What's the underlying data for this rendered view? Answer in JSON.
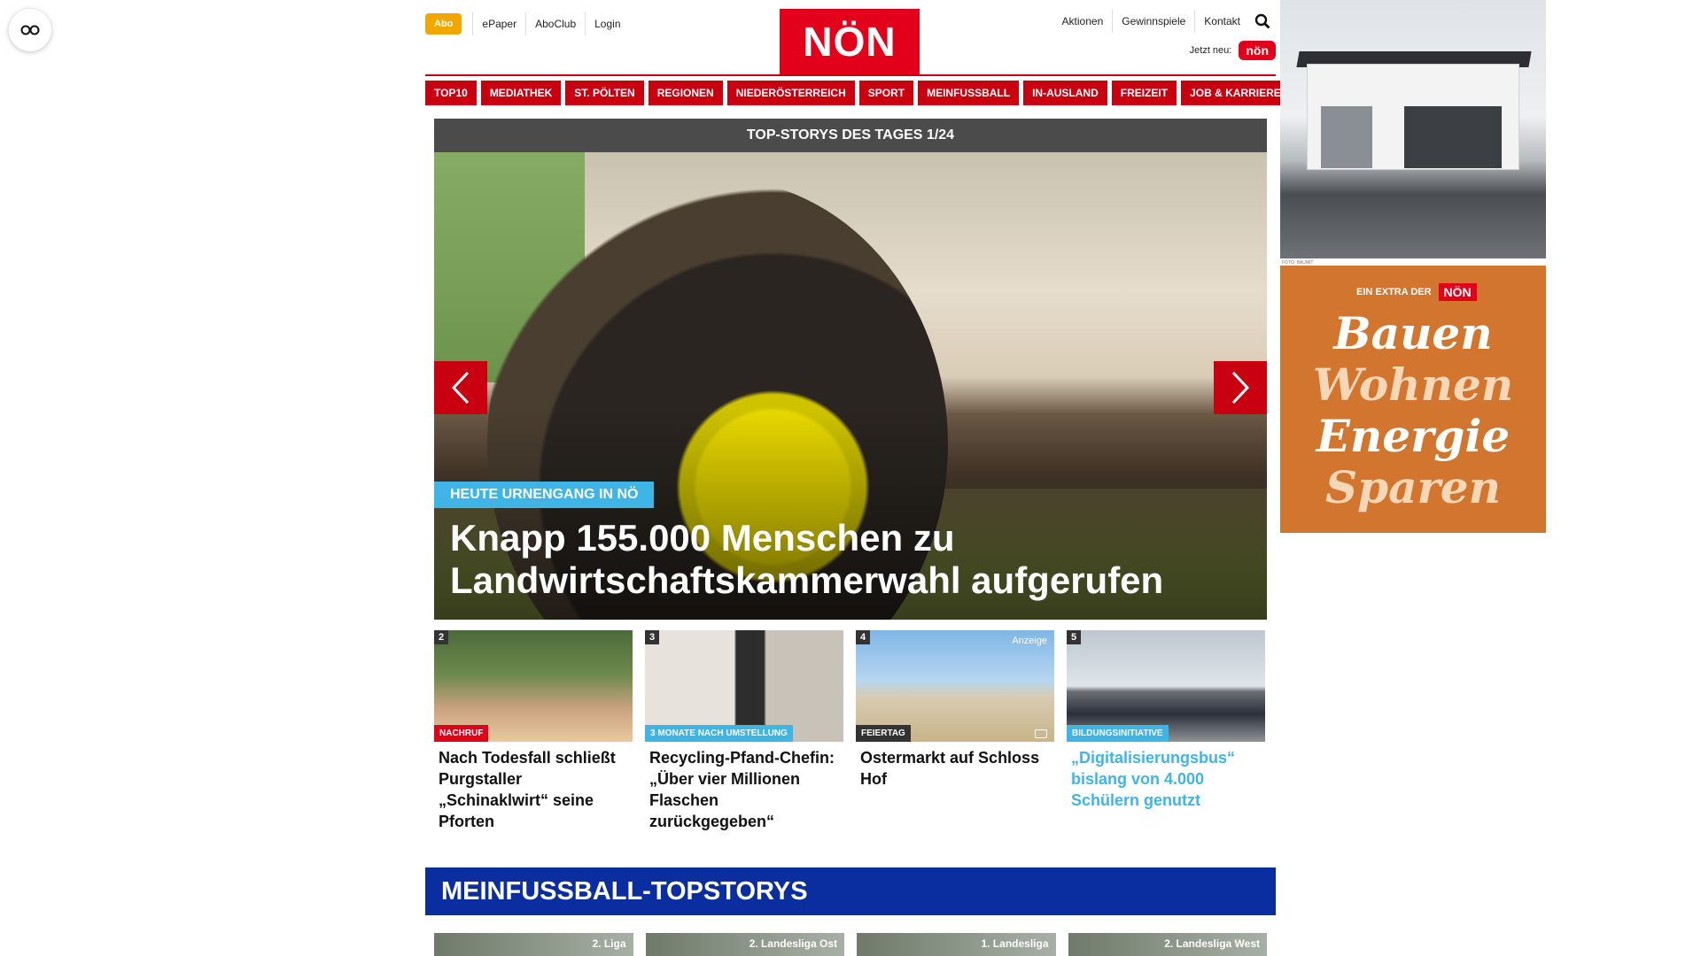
{
  "reader_icon": "reading-glasses-icon",
  "header": {
    "abo": "Abo",
    "left_links": [
      "ePaper",
      "AboClub",
      "Login"
    ],
    "logo": "NÖN",
    "right_links": [
      "Aktionen",
      "Gewinnspiele",
      "Kontakt"
    ],
    "jetzt_label": "Jetzt neu:",
    "kleine_logo": "nön"
  },
  "nav": [
    "TOP10",
    "MEDIATHEK",
    "ST. PÖLTEN",
    "REGIONEN",
    "NIEDERÖSTERREICH",
    "SPORT",
    "MEINFUSSBALL",
    "IN-AUSLAND",
    "FREIZEIT",
    "JOB & KARRIERE"
  ],
  "hero": {
    "section_title": "TOP-STORYS DES TAGES 1/24",
    "tag": "HEUTE URNENGANG IN NÖ",
    "headline": "Knapp 155.000 Menschen zu Landwirtschaftskammerwahl aufgerufen"
  },
  "cards": [
    {
      "num": "2",
      "tag": "NACHRUF",
      "tag_color": "#e2001a",
      "title": "Nach Todesfall schließt Purgstaller „Schinaklwirt“ seine Pforten"
    },
    {
      "num": "3",
      "tag": "3 MONATE NACH UMSTELLUNG",
      "tag_color": "#3fb4e6",
      "title": "Recycling-Pfand-Chefin: „Über vier Millionen Flaschen zurückgegeben“"
    },
    {
      "num": "4",
      "tag": "FEIERTAG",
      "tag_color": "#333333",
      "anzeige": "Anzeige",
      "title": "Ostermarkt auf Schloss Hof"
    },
    {
      "num": "5",
      "tag": "BILDUNGSINITIATIVE",
      "tag_color": "#3fb4e6",
      "title": "„Digitalisierungsbus“ bislang von 4.000 Schülern genutzt"
    }
  ],
  "meinfussball": {
    "title": "MEINFUSSBALL-TOPSTORYS",
    "leagues": [
      "2. Liga",
      "2. Landesliga Ost",
      "1. Landesliga",
      "2. Landesliga West"
    ]
  },
  "ads": {
    "extra_text": "EIN EXTRA DER",
    "extra_logo": "NÖN",
    "words": [
      "Bauen",
      "Wohnen",
      "Energie",
      "Sparen"
    ],
    "caption": "FOTO: BAUMIT"
  },
  "colors": {
    "brand_red": "#e2001a",
    "nav_red": "#c8000f",
    "accent_blue": "#3fb4e6",
    "fussball_blue": "#0a2ea0",
    "abo_orange": "#f3a600"
  }
}
